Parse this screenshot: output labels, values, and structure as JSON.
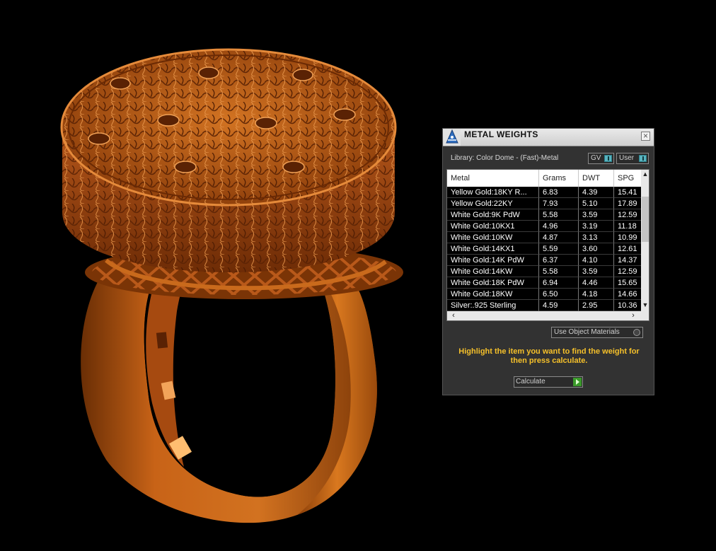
{
  "window": {
    "title": "METAL WEIGHTS",
    "close_label": "×",
    "library_label": "Library: Color Dome - (Fast)-Metal",
    "toggle_gv_label": "GV",
    "toggle_user_label": "User"
  },
  "table": {
    "headers": [
      "Metal",
      "Grams",
      "DWT",
      "SPG"
    ],
    "rows": [
      [
        "Yellow Gold:18KY R...",
        "6.83",
        "4.39",
        "15.41"
      ],
      [
        "Yellow Gold:22KY",
        "7.93",
        "5.10",
        "17.89"
      ],
      [
        "White Gold:9K PdW",
        "5.58",
        "3.59",
        "12.59"
      ],
      [
        "White Gold:10KX1",
        "4.96",
        "3.19",
        "11.18"
      ],
      [
        "White Gold:10KW",
        "4.87",
        "3.13",
        "10.99"
      ],
      [
        "White Gold:14KX1",
        "5.59",
        "3.60",
        "12.61"
      ],
      [
        "White Gold:14K PdW",
        "6.37",
        "4.10",
        "14.37"
      ],
      [
        "White Gold:14KW",
        "5.58",
        "3.59",
        "12.59"
      ],
      [
        "White Gold:18K PdW",
        "6.94",
        "4.46",
        "15.65"
      ],
      [
        "White Gold:18KW",
        "6.50",
        "4.18",
        "14.66"
      ],
      [
        "Silver:.925 Sterling",
        "4.59",
        "2.95",
        "10.36"
      ]
    ]
  },
  "controls": {
    "use_object_materials_label": "Use Object Materials",
    "hint_text": "Highlight the item you want to find the weight for then press calculate.",
    "calculate_label": "Calculate"
  },
  "colors": {
    "metal_orange": "#c8661a",
    "hint_yellow": "#f5c02a",
    "toggle_teal": "#59b4c0"
  }
}
